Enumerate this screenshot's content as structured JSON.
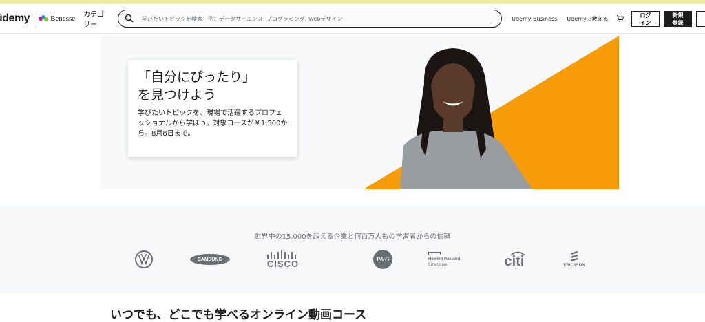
{
  "header": {
    "logo_text": "ūdemy",
    "partner_text": "Benesse",
    "categories_label": "カテゴリー",
    "search_placeholder": "学びたいトピックを検索　例：データサイエンス, プログラミング, Webデザイン",
    "business_link": "Udemy Business",
    "teach_link": "Udemyで教える",
    "login_label": "ログイン",
    "signup_label": "新規登録"
  },
  "hero": {
    "title": "「自分にぴったり」\nを見つけよう",
    "subtitle": "学びたいトピックを、現場で活躍するプロフェッショナルから学ぼう。対象コースが￥1,500から。8月8日まで。",
    "accent_color": "#f69c08"
  },
  "trust": {
    "title": "世界中の15,000を超える企業と何百万人もの学習者からの信頼",
    "logos": [
      {
        "name": "volkswagen-logo",
        "text": "VW"
      },
      {
        "name": "samsung-logo",
        "text": "SAMSUNG"
      },
      {
        "name": "cisco-logo",
        "text": "CISCO"
      },
      {
        "name": "pg-logo",
        "text": "P&G"
      },
      {
        "name": "hpe-logo",
        "text_top": "Hewlett Packard",
        "text_bottom": "Enterprise"
      },
      {
        "name": "citi-logo",
        "text": "citi"
      },
      {
        "name": "ericsson-logo",
        "text": "ERICSSON"
      }
    ]
  },
  "section": {
    "heading": "いつでも、どこでも学べるオンライン動画コース"
  }
}
